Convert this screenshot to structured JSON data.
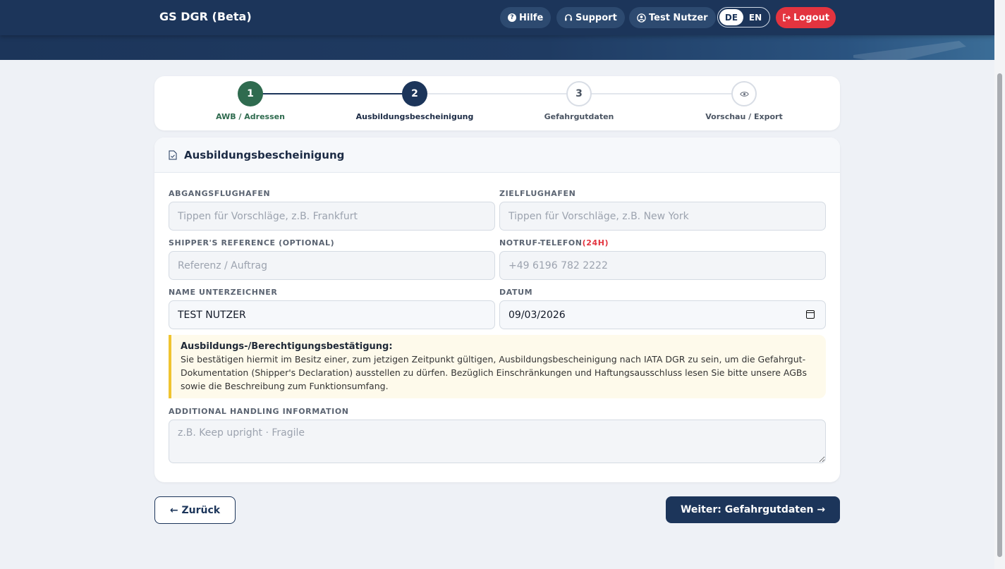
{
  "header": {
    "brand": "GS DGR (Beta)",
    "help_label": "Hilfe",
    "support_label": "Support",
    "user_label": "Test Nutzer",
    "lang_de": "DE",
    "lang_en": "EN",
    "logout_label": "Logout"
  },
  "stepper": {
    "steps": [
      {
        "number": "1",
        "label": "AWB / Adressen",
        "state": "done"
      },
      {
        "number": "2",
        "label": "Ausbildungsbescheinigung",
        "state": "active"
      },
      {
        "number": "3",
        "label": "Gefahrgutdaten",
        "state": "pending"
      },
      {
        "number": "",
        "icon": "eye-icon",
        "label": "Vorschau / Export",
        "state": "pending"
      }
    ]
  },
  "form": {
    "title": "Ausbildungsbescheinigung",
    "departure": {
      "label": "ABGANGSFLUGHAFEN",
      "placeholder": "Tippen für Vorschläge, z.B. Frankfurt",
      "value": ""
    },
    "destination": {
      "label": "ZIELFLUGHAFEN",
      "placeholder": "Tippen für Vorschläge, z.B. New York",
      "value": ""
    },
    "reference": {
      "label": "SHIPPER'S REFERENCE (OPTIONAL)",
      "placeholder": "Referenz / Auftrag",
      "value": ""
    },
    "emergency": {
      "label": "NOTRUF-TELEFON",
      "required_mark": "(24H)",
      "placeholder": "+49 6196 782 2222",
      "value": ""
    },
    "signer": {
      "label": "NAME UNTERZEICHNER",
      "value": "TEST NUTZER"
    },
    "date": {
      "label": "DATUM",
      "value": "09/03/2026"
    },
    "notice": {
      "title": "Ausbildungs-/Berechtigungsbestätigung:",
      "body": "Sie bestätigen hiermit im Besitz einer, zum jetzigen Zeitpunkt gültigen, Ausbildungsbescheinigung nach IATA DGR zu sein, um die Gefahrgut-Dokumentation (Shipper's Declaration) ausstellen zu dürfen. Bezüglich Einschränkungen und Haftungsausschluss lesen Sie bitte unsere AGBs sowie die Beschreibung zum Funktionsumfang."
    },
    "handling": {
      "label": "ADDITIONAL HANDLING INFORMATION",
      "placeholder": "z.B. Keep upright · Fragile",
      "value": ""
    }
  },
  "nav": {
    "back_label": "← Zurück",
    "next_label": "Weiter: Gefahrgutdaten →"
  },
  "colors": {
    "navy": "#1c355a",
    "green_done": "#2f6b4f",
    "danger": "#e3343f",
    "warning_border": "#f0c430"
  }
}
